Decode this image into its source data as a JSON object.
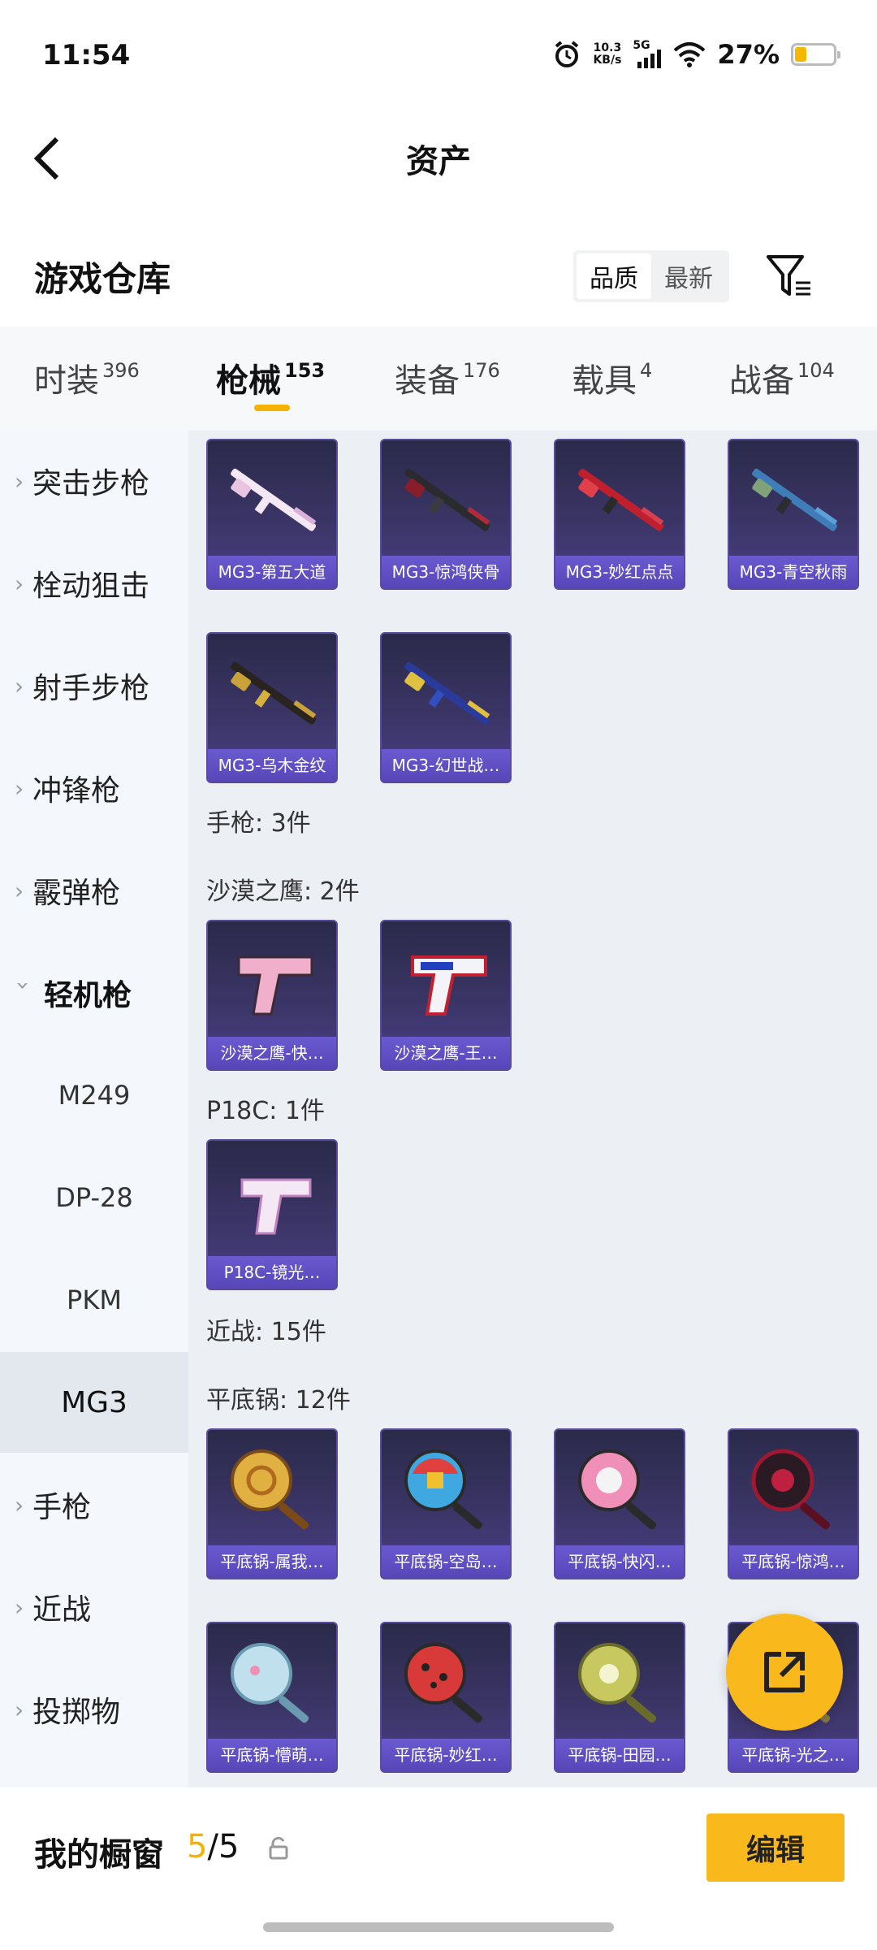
{
  "status": {
    "time": "11:54",
    "net_speed_value": "10.3",
    "net_speed_unit": "KB/s",
    "net_type": "5G",
    "battery": "27%",
    "battery_level": 0.27
  },
  "header": {
    "title": "资产"
  },
  "warehouse": {
    "title": "游戏仓库",
    "sort_options": [
      "品质",
      "最新"
    ],
    "sort_active": "品质"
  },
  "tabs": [
    {
      "label": "时装",
      "count": "396"
    },
    {
      "label": "枪械",
      "count": "153"
    },
    {
      "label": "装备",
      "count": "176"
    },
    {
      "label": "载具",
      "count": "4"
    },
    {
      "label": "战备",
      "count": "104"
    }
  ],
  "active_tab": "枪械",
  "sidebar": {
    "items": [
      "突击步枪",
      "栓动狙击",
      "射手步枪",
      "冲锋枪",
      "霰弹枪",
      "轻机枪"
    ],
    "sub_items": [
      "M249",
      "DP-28",
      "PKM",
      "MG3"
    ],
    "active_sub": "MG3",
    "items_after": [
      "手枪",
      "近战",
      "投掷物"
    ]
  },
  "content": {
    "mg3_items": [
      "MG3-第五大道",
      "MG3-惊鸿侠骨",
      "MG3-妙红点点",
      "MG3-青空秋雨",
      "MG3-乌木金纹",
      "MG3-幻世战…"
    ],
    "pistol_header": "手枪: 3件",
    "deagle_header": "沙漠之鹰: 2件",
    "deagle_items": [
      "沙漠之鹰-快…",
      "沙漠之鹰-王…"
    ],
    "p18c_header": "P18C: 1件",
    "p18c_items": [
      "P18C-镜光…"
    ],
    "melee_header": "近战: 15件",
    "pan_header": "平底锅: 12件",
    "pan_items": [
      "平底锅-属我…",
      "平底锅-空岛…",
      "平底锅-快闪…",
      "平底锅-惊鸿…",
      "平底锅-懵萌…",
      "平底锅-妙红…",
      "平底锅-田园…",
      "平底锅-光之…"
    ]
  },
  "bottom": {
    "label": "我的橱窗",
    "count_current": "5",
    "count_sep": "/",
    "count_total": "5",
    "edit_label": "编辑"
  },
  "colors": {
    "accent": "#f9b81c",
    "card_bg": "#3b3566",
    "card_caption": "#5746b8",
    "content_bg": "#eceff4",
    "sidebar_bg": "#f4f7fb"
  }
}
